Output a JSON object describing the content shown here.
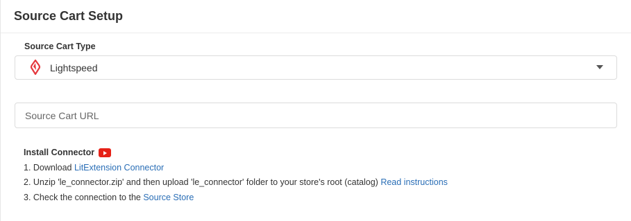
{
  "header": {
    "title": "Source Cart Setup"
  },
  "source_cart_type": {
    "label": "Source Cart Type",
    "selected": "Lightspeed",
    "logo_icon": "lightspeed-logo-icon",
    "logo_color": "#e5373d"
  },
  "source_url": {
    "placeholder": "Source Cart URL",
    "value": ""
  },
  "install": {
    "title": "Install Connector",
    "video_icon": "youtube-icon",
    "step1_prefix": "1. Download ",
    "step1_link": "LitExtension Connector",
    "step2_prefix": "2. Unzip 'le_connector.zip' and then upload 'le_connector' folder to your store's root (catalog) ",
    "step2_link": "Read instructions",
    "step3_prefix": "3. Check the connection to the ",
    "step3_link": "Source Store"
  },
  "colors": {
    "link": "#2a6eb6",
    "youtube": "#e62117"
  }
}
